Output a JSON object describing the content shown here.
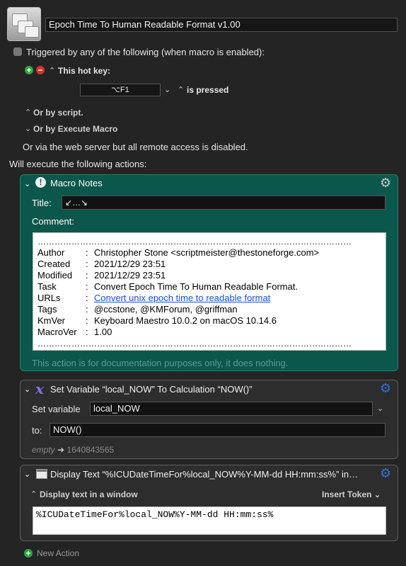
{
  "macro": {
    "name": "Epoch Time To Human Readable Format v1.00"
  },
  "triggers": {
    "triggered_label": "Triggered by any of the following (when macro is enabled):",
    "hotkey_label": "This hot key:",
    "hotkey_value": "⌥F1",
    "hotkey_mode": "is pressed",
    "or_script": "Or by script.",
    "or_execute_macro": "Or by Execute Macro",
    "web_server": "Or via the web server but all remote access is disabled."
  },
  "actions": {
    "heading": "Will execute the following actions:",
    "new_action": "New Action"
  },
  "macro_notes": {
    "header": "Macro Notes",
    "title_label": "Title:",
    "title_value": "↙…↘",
    "comment_label": "Comment:",
    "dots": "…………………………………………………………………………………………………",
    "rows": [
      {
        "key": "Author",
        "sep": ":",
        "value": "Christopher Stone <scriptmeister@thestoneforge.com>"
      },
      {
        "key": "Created",
        "sep": ":",
        "value": "2021/12/29 23:51"
      },
      {
        "key": "Modified",
        "sep": ":",
        "value": "2021/12/29 23:51"
      },
      {
        "key": "Task",
        "sep": ":",
        "value": "Convert Epoch Time To Human Readable Format."
      },
      {
        "key": "URLs",
        "sep": ":",
        "value": "Convert unix epoch time to readable format"
      },
      {
        "key": "Tags",
        "sep": ":",
        "value": "@ccstone, @KMForum, @griffman"
      },
      {
        "key": "KmVer",
        "sep": ":",
        "value": "Keyboard Maestro 10.0.2 on macOS 10.14.6"
      },
      {
        "key": "MacroVer",
        "sep": ":",
        "value": "1.00"
      }
    ],
    "footer": "This action is for documentation purposes only, it does nothing."
  },
  "set_variable": {
    "header": "Set Variable “local_NOW” To Calculation “NOW()”",
    "var_label": "Set variable",
    "var_value": "local_NOW",
    "to_label": "to:",
    "to_value": "NOW()",
    "preview_empty": "empty",
    "preview_arrow": "➔",
    "preview_value": "1640843565"
  },
  "display_text": {
    "header": "Display Text “%ICUDateTimeFor%local_NOW%Y-MM-dd HH:mm:ss%” in…",
    "mode_label": "Display text in a window",
    "insert_token": "Insert Token",
    "text_value": "%ICUDateTimeFor%local_NOW%Y-MM-dd HH:mm:ss%"
  },
  "colors": {
    "notes_bg": "#0c574b",
    "accent_blue": "#2f6fe0",
    "add_green": "#2aa83a",
    "remove_red": "#d8322b"
  }
}
